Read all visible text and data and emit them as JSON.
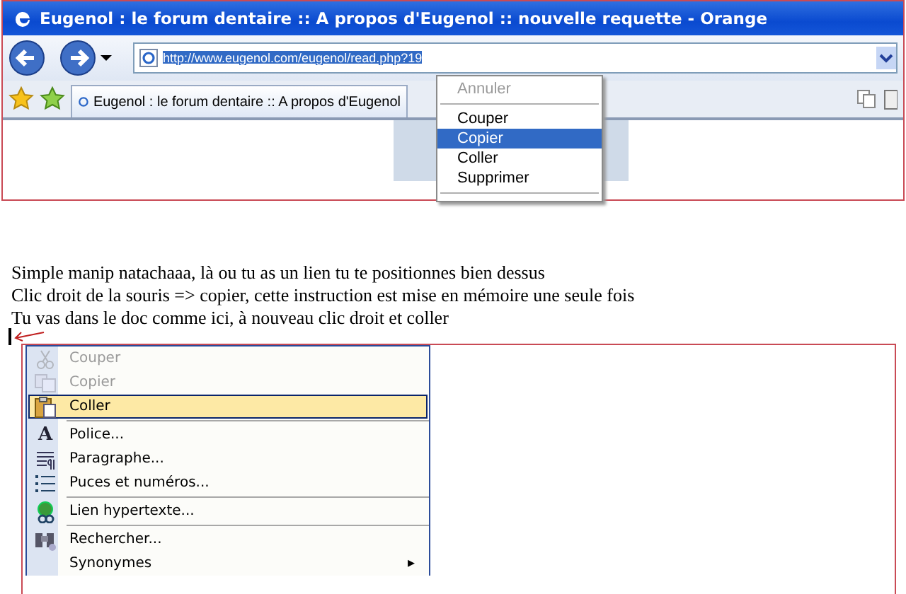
{
  "browser_screenshot": {
    "title": "Eugenol : le forum dentaire :: A propos d'Eugenol :: nouvelle requette - Orange",
    "address": "http://www.eugenol.com/eugenol/read.php?19",
    "tab_title": "Eugenol : le forum dentaire :: A propos d'Eugenol",
    "context_menu": [
      {
        "label": "Annuler",
        "disabled": true,
        "selected": false,
        "separator_after": true
      },
      {
        "label": "Couper",
        "disabled": false,
        "selected": false,
        "separator_after": false
      },
      {
        "label": "Copier",
        "disabled": false,
        "selected": true,
        "separator_after": false
      },
      {
        "label": "Coller",
        "disabled": false,
        "selected": false,
        "separator_after": false
      },
      {
        "label": "Supprimer",
        "disabled": false,
        "selected": false,
        "separator_after": true
      }
    ]
  },
  "instructions": [
    "Simple manip natachaaa, là ou tu as un lien tu te positionnes bien dessus",
    "Clic droit de la souris => copier, cette instruction est mise en mémoire une seule fois",
    "Tu vas dans le doc comme ici,  à nouveau clic droit et coller"
  ],
  "word_context_menu": [
    {
      "kind": "scissors",
      "label": "Couper",
      "disabled": true,
      "selected": false,
      "separator_after": false
    },
    {
      "kind": "copy",
      "label": "Copier",
      "disabled": true,
      "selected": false,
      "separator_after": false
    },
    {
      "kind": "paste",
      "label": "Coller",
      "disabled": false,
      "selected": true,
      "separator_after": true
    },
    {
      "kind": "glyph",
      "glyph": "A",
      "label": "Police...",
      "disabled": false,
      "selected": false,
      "separator_after": false
    },
    {
      "kind": "paragraph",
      "label": "Paragraphe...",
      "disabled": false,
      "selected": false,
      "separator_after": false
    },
    {
      "kind": "list",
      "label": "Puces et numéros...",
      "disabled": false,
      "selected": false,
      "separator_after": true
    },
    {
      "kind": "globe",
      "label": "Lien hypertexte...",
      "disabled": false,
      "selected": false,
      "separator_after": true
    },
    {
      "kind": "search",
      "label": "Rechercher...",
      "disabled": false,
      "selected": false,
      "separator_after": false
    },
    {
      "kind": "submenu",
      "label": "Synonymes",
      "arrow": "▸",
      "disabled": false,
      "selected": false,
      "separator_after": false
    }
  ]
}
